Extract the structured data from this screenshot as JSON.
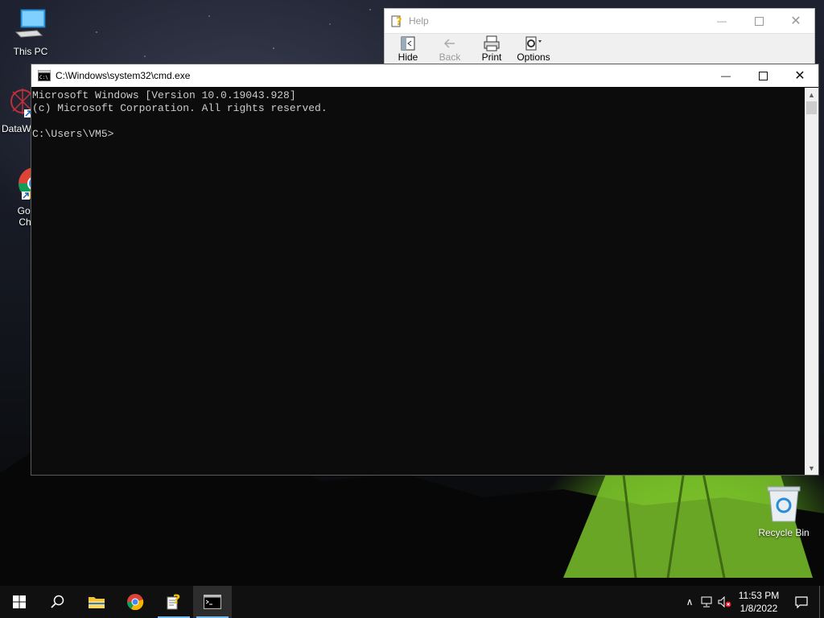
{
  "desktop": {
    "icons": [
      {
        "label": "This PC"
      },
      {
        "label": "DataW"
      },
      {
        "label": "Goo\nChr"
      },
      {
        "label": "Recycle Bin"
      }
    ]
  },
  "help_window": {
    "title": "Help",
    "toolbar": [
      {
        "label": "Hide",
        "enabled": true
      },
      {
        "label": "Back",
        "enabled": false
      },
      {
        "label": "Print",
        "enabled": true
      },
      {
        "label": "Options",
        "enabled": true
      }
    ]
  },
  "cmd_window": {
    "title": "C:\\Windows\\system32\\cmd.exe",
    "console_text": "Microsoft Windows [Version 10.0.19043.928]\n(c) Microsoft Corporation. All rights reserved.\n\nC:\\Users\\VM5>"
  },
  "taskbar": {
    "items": [
      "start",
      "search",
      "file-explorer",
      "chrome",
      "help-viewer",
      "command-prompt"
    ],
    "active_item": "command-prompt",
    "clock_time": "11:53 PM",
    "clock_date": "1/8/2022"
  },
  "colors": {
    "console_bg": "#0c0c0c",
    "console_fg": "#cccccc",
    "taskbar_bg": "#101010",
    "accent": "#76b9ed"
  }
}
